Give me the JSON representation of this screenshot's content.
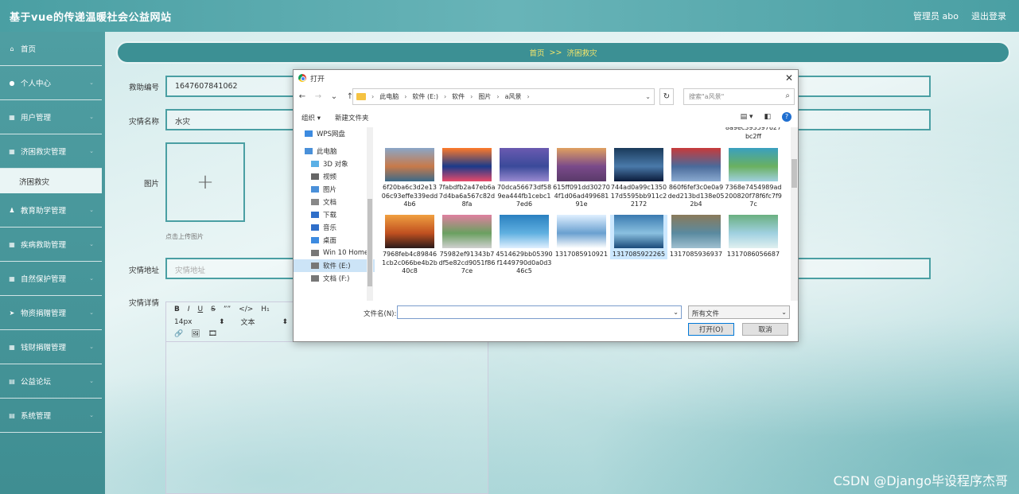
{
  "site_title": "基于vue的传递温暖社会公益网站",
  "header": {
    "user_label": "管理员 abo",
    "logout_label": "退出登录"
  },
  "sidebar": {
    "items": [
      {
        "label": "首页",
        "icon": "home-icon",
        "glyph": "⌂"
      },
      {
        "label": "个人中心",
        "icon": "user-icon",
        "glyph": "●",
        "chevron": "⌄"
      },
      {
        "label": "用户管理",
        "icon": "grid-icon",
        "glyph": "▦",
        "chevron": "⌄"
      },
      {
        "label": "济困救灾管理",
        "icon": "grid-icon",
        "glyph": "▦",
        "chevron": "⌄"
      },
      {
        "label": "教育助学管理",
        "icon": "person-icon",
        "glyph": "♟",
        "chevron": "⌄"
      },
      {
        "label": "疾病救助管理",
        "icon": "grid-icon",
        "glyph": "▦",
        "chevron": "⌄"
      },
      {
        "label": "自然保护管理",
        "icon": "grid-icon",
        "glyph": "▦",
        "chevron": "⌄"
      },
      {
        "label": "物资捐赠管理",
        "icon": "send-icon",
        "glyph": "➤",
        "chevron": "⌄"
      },
      {
        "label": "钱财捐赠管理",
        "icon": "grid-icon",
        "glyph": "▦",
        "chevron": "⌄"
      },
      {
        "label": "公益论坛",
        "icon": "doc-icon",
        "glyph": "▤",
        "chevron": "⌄"
      },
      {
        "label": "系统管理",
        "icon": "doc-icon",
        "glyph": "▤",
        "chevron": "⌄"
      }
    ],
    "active_sub": "济困救灾"
  },
  "breadcrumb": {
    "home": "首页",
    "sep": ">>",
    "current": "济困救灾"
  },
  "form": {
    "id_label": "救助编号",
    "id_value": "1647607841062",
    "name_label": "灾情名称",
    "name_value": "水灾",
    "image_label": "图片",
    "upload_plus": "+",
    "upload_hint": "点击上传图片",
    "address_label": "灾情地址",
    "address_placeholder": "灾情地址",
    "detail_label": "灾情详情"
  },
  "editor": {
    "bold": "B",
    "italic": "I",
    "underline": "U",
    "strike": "S",
    "quote": "””",
    "code": "</>",
    "heading": "H₁",
    "font_size": "14px",
    "font_size_dd": "⬍",
    "text_style": "文本",
    "text_style_dd": "⬍",
    "link": "🔗",
    "image": "🖼",
    "video": "🎞"
  },
  "dialog": {
    "title": "打开",
    "close": "✕",
    "back": "←",
    "forward": "→",
    "recent": "⌄",
    "up": "↑",
    "path": [
      "此电脑",
      "软件 (E:)",
      "软件",
      "图片",
      "a风景"
    ],
    "crumb_sep": "›",
    "address_dd": "⌄",
    "refresh": "↻",
    "search_placeholder": "搜索\"a风景\"",
    "search_glyph": "⌕",
    "organize": "组织 ▾",
    "new_folder": "新建文件夹",
    "view_btn": "▤ ▾",
    "pane_btn": "◧",
    "help": "?",
    "nav_items": [
      {
        "label": "WPS网盘",
        "icon": "cloud-icon",
        "indent": false,
        "selected": false,
        "color": "#3d8be0"
      },
      {
        "label": "此电脑",
        "icon": "computer-icon",
        "indent": false,
        "selected": false,
        "color": "#4a90d9"
      },
      {
        "label": "3D 对象",
        "icon": "cube-icon",
        "indent": true,
        "selected": false,
        "color": "#5ab0e6"
      },
      {
        "label": "视频",
        "icon": "video-icon",
        "indent": true,
        "selected": false,
        "color": "#666666"
      },
      {
        "label": "图片",
        "icon": "pictures-icon",
        "indent": true,
        "selected": false,
        "color": "#4a90d9"
      },
      {
        "label": "文档",
        "icon": "documents-icon",
        "indent": true,
        "selected": false,
        "color": "#888888"
      },
      {
        "label": "下载",
        "icon": "download-icon",
        "indent": true,
        "selected": false,
        "color": "#2f6fc9"
      },
      {
        "label": "音乐",
        "icon": "music-icon",
        "indent": true,
        "selected": false,
        "color": "#2f6fc9"
      },
      {
        "label": "桌面",
        "icon": "desktop-icon",
        "indent": true,
        "selected": false,
        "color": "#3d8be0"
      },
      {
        "label": "Win 10 Home",
        "icon": "drive-icon",
        "indent": true,
        "selected": false,
        "color": "#777777"
      },
      {
        "label": "软件 (E:)",
        "icon": "drive-icon",
        "indent": true,
        "selected": true,
        "color": "#777777"
      },
      {
        "label": "文档 (F:)",
        "icon": "drive-icon",
        "indent": true,
        "selected": false,
        "color": "#777777"
      }
    ],
    "files": [
      {
        "name": "6f20ba6c3d2e1306c93effe339edd4b6",
        "colors": [
          "#8aa6c8",
          "#c87a4a",
          "#3a6a8a"
        ],
        "selected": false
      },
      {
        "name": "7fabdfb2a47eb6a7d4ba6a567c82d8fa",
        "colors": [
          "#ff7a2a",
          "#1a3a8a",
          "#e84a6a"
        ],
        "selected": false
      },
      {
        "name": "70dca56673df589ea444fb1cebc17ed6",
        "colors": [
          "#6a5ab0",
          "#3a4a9a",
          "#9a8ad0"
        ],
        "selected": false
      },
      {
        "name": "615ff091dd302704f1d06ad49968191e",
        "colors": [
          "#e0a060",
          "#7a4a8a",
          "#5a3a6a"
        ],
        "selected": false
      },
      {
        "name": "744ad0a99c135017d5595bb911c22172",
        "colors": [
          "#1a3a5a",
          "#4a7aaa",
          "#0a1a3a"
        ],
        "selected": false
      },
      {
        "name": "860f6fef3c0e0a9ded213bd138e052b4",
        "colors": [
          "#c83a3a",
          "#4a6a9a",
          "#8aaad0"
        ],
        "selected": false
      },
      {
        "name": "7368e7454989ad200820f78f6fc7f97c",
        "colors": [
          "#3aa0c0",
          "#6ab060",
          "#a0d0e0"
        ],
        "selected": false
      },
      {
        "name": "7968feb4c898461cb2c066be4b2b40c8",
        "colors": [
          "#f0a040",
          "#c05020",
          "#2a1a1a"
        ],
        "selected": false
      },
      {
        "name": "75982ef91343b7df5e82cd9051f867ce",
        "colors": [
          "#e080a0",
          "#6aa060",
          "#d0d0d0"
        ],
        "selected": false
      },
      {
        "name": "4514629bb05390f1449790d0a0d346c5",
        "colors": [
          "#2a80c0",
          "#60b0e0",
          "#e0f0ff"
        ],
        "selected": false
      },
      {
        "name": "1317085910921",
        "colors": [
          "#e0f0ff",
          "#6aa0d0",
          "#ffffff"
        ],
        "selected": false
      },
      {
        "name": "1317085922265",
        "colors": [
          "#3a7ab0",
          "#8ac0e0",
          "#1a4a7a"
        ],
        "selected": true
      },
      {
        "name": "1317085936937",
        "colors": [
          "#8a7a5a",
          "#5a8aa0",
          "#a0c0d0"
        ],
        "selected": false
      },
      {
        "name": "1317086056687",
        "colors": [
          "#6ab080",
          "#a0d0e0",
          "#e0f0f0"
        ],
        "selected": false
      }
    ],
    "top_partial_files": [
      "8a9ec393597627bc2ff"
    ],
    "filename_label": "文件名(N):",
    "filename_value": "",
    "filetype_value": "所有文件",
    "dd_glyph": "⌄",
    "open_button": "打开(O)",
    "cancel_button": "取消"
  },
  "watermark": "CSDN @Django毕设程序杰哥",
  "colors": {
    "teal": "#4a9fa3",
    "breadcrumb_text": "#f5e56a"
  }
}
